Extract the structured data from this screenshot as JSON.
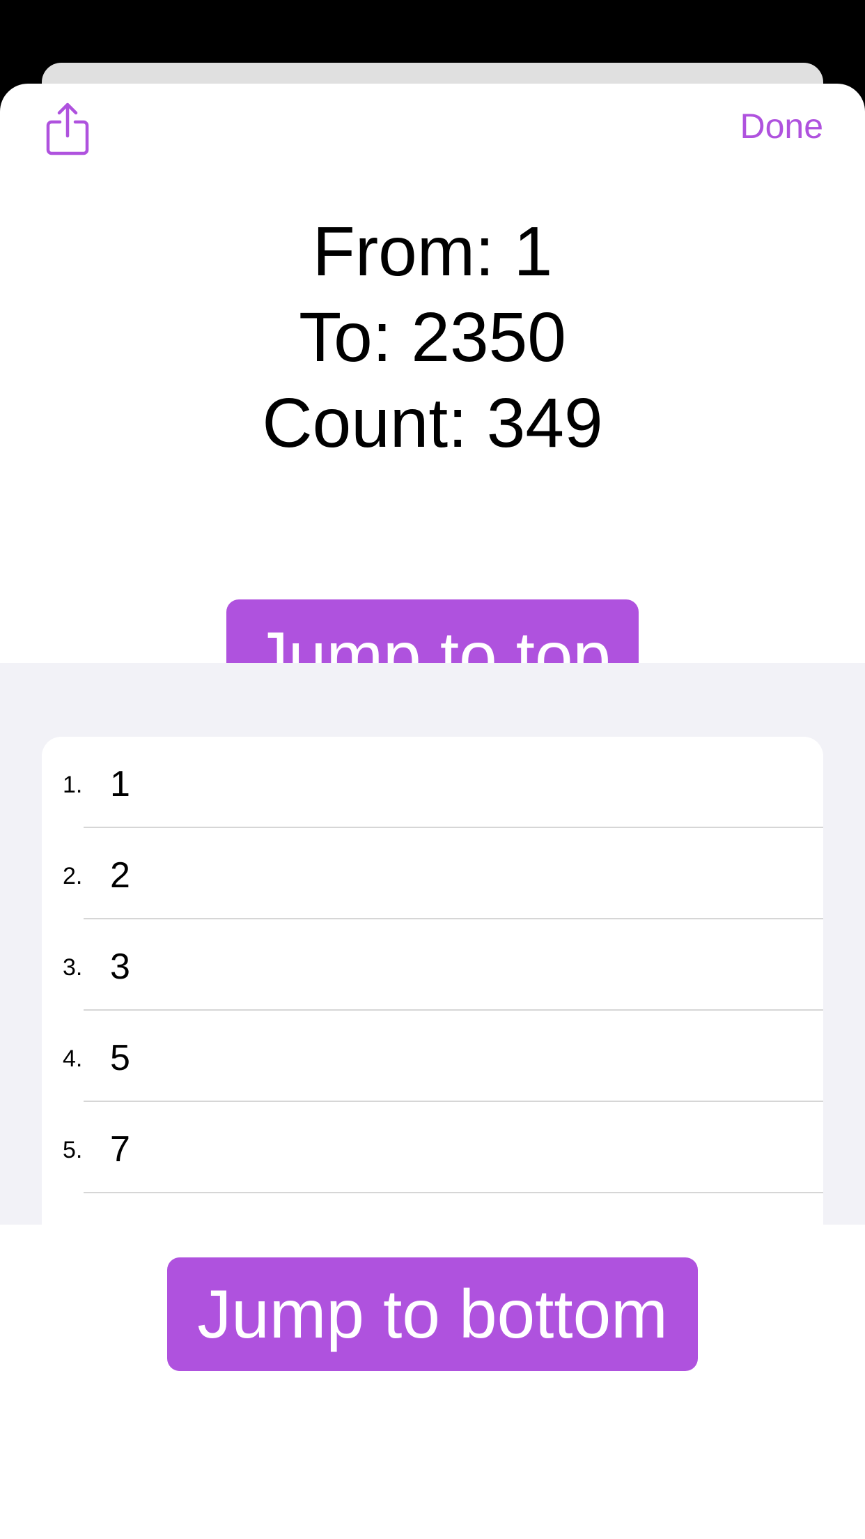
{
  "colors": {
    "accent": "#af52de",
    "list_background": "#f2f2f7"
  },
  "nav": {
    "share_icon": "share-icon",
    "done_label": "Done"
  },
  "stats": {
    "from": "From: 1",
    "to": "To: 2350",
    "count": "Count: 349"
  },
  "buttons": {
    "jump_top": "Jump to top",
    "jump_bottom": "Jump to bottom"
  },
  "list": {
    "items": [
      {
        "index": "1.",
        "value": "1"
      },
      {
        "index": "2.",
        "value": "2"
      },
      {
        "index": "3.",
        "value": "3"
      },
      {
        "index": "4.",
        "value": "5"
      },
      {
        "index": "5.",
        "value": "7"
      }
    ]
  }
}
